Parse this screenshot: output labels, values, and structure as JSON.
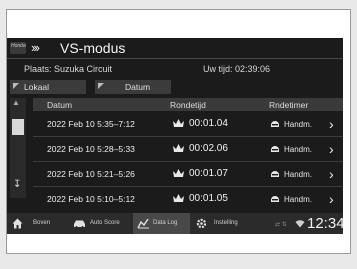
{
  "header": {
    "logo_text": "Honda",
    "chevrons": "›››",
    "title": "VS-modus"
  },
  "info": {
    "place": "Plaats: Suzuka Circuit",
    "uw_tijd": "Uw tijd: 02:39:06"
  },
  "sort": {
    "lokaal": "Lokaal",
    "datum": "Datum"
  },
  "table": {
    "headers": [
      "Datum",
      "Rondetijd",
      "Rndetimer"
    ],
    "rows": [
      {
        "date": "2022 Feb 10  5:35–7:12",
        "lap": "00:01.04",
        "timer": "Handm."
      },
      {
        "date": "2022 Feb 10  5:28–5:33",
        "lap": "00:02.06",
        "timer": "Handm."
      },
      {
        "date": "2022 Feb 10  5:21–5:26",
        "lap": "00:01.07",
        "timer": "Handm."
      },
      {
        "date": "2022 Feb 10  5:10–5:12",
        "lap": "00:01.05",
        "timer": "Handm."
      }
    ]
  },
  "bottom": {
    "items": [
      {
        "label": "Boven",
        "icon": "home-icon"
      },
      {
        "label": "Auto Score",
        "icon": "car-icon"
      },
      {
        "label": "Data Log",
        "icon": "data-log-icon"
      },
      {
        "label": "Instelling",
        "icon": "gear-icon"
      }
    ],
    "clock": "12:34"
  },
  "colors": {
    "screen_bg": "#1b1b1b",
    "header_bar": "#3a3a3a",
    "text": "#e8e8e8"
  }
}
